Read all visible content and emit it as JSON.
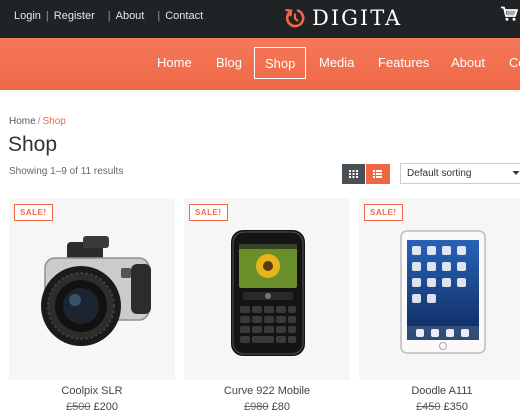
{
  "topbar": {
    "links": [
      "Login",
      "Register",
      "About",
      "Contact"
    ],
    "separator": "|",
    "logo_text": "DIGITA",
    "cart_icon": "cart-icon"
  },
  "nav": {
    "items": [
      "Home",
      "Blog",
      "Shop",
      "Media",
      "Features",
      "About",
      "Co"
    ],
    "active": "Shop"
  },
  "breadcrumb": {
    "home": "Home",
    "separator": "/",
    "current": "Shop"
  },
  "page": {
    "title": "Shop",
    "result_count": "Showing 1–9 of 11 results"
  },
  "view_toggle": {
    "grid_icon": "grid-view-icon",
    "list_icon": "list-view-icon"
  },
  "sorting": {
    "selected": "Default sorting"
  },
  "products": [
    {
      "badge": "SALE!",
      "name": "Coolpix SLR",
      "old_price": "£500",
      "price": "£200",
      "image": "camera-image"
    },
    {
      "badge": "SALE!",
      "name": "Curve 922 Mobile",
      "old_price": "£980",
      "price": "£80",
      "image": "phone-image"
    },
    {
      "badge": "SALE!",
      "name": "Doodle A111",
      "old_price": "£450",
      "price": "£350",
      "image": "tablet-image"
    }
  ],
  "colors": {
    "accent": "#ef6846",
    "topbar": "#1f2326",
    "card_bg": "#f6f6f6"
  }
}
